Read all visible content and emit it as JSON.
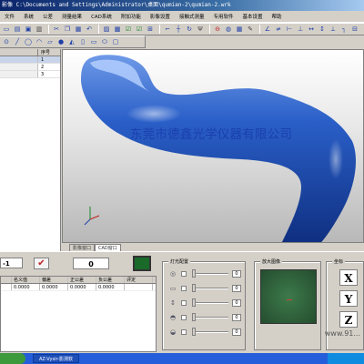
{
  "window": {
    "title": "影像  C:\\Documents and Settings\\Administrator\\桌面\\qumian-2\\qumian-2.wrk"
  },
  "menu": [
    "文件",
    "系统",
    "公差",
    "测量结果",
    "CAD系统",
    "附加功能",
    "影像设置",
    "接触式测量",
    "专用软件",
    "基本设置",
    "帮助"
  ],
  "toolbar_row1": {
    "icons": [
      "new-icon",
      "open-icon",
      "save-icon",
      "print-icon",
      "cut-icon",
      "copy-icon",
      "paste-icon",
      "undo-icon",
      "chart-icon",
      "measure-icon",
      "check-icon",
      "check-icon",
      "zoom-icon",
      "frame-icon",
      "crosshair-icon",
      "rotate-icon",
      "stop-icon",
      "camera-icon",
      "dim-icon",
      "line-icon",
      "angle-icon",
      "ruler-icon",
      "probe-icon",
      "light-icon",
      "grid-icon"
    ]
  },
  "left_panel": {
    "header": "序号",
    "rows": [
      "1",
      "2",
      "3"
    ]
  },
  "viewport": {
    "watermark": "东莞市德鑫光学仪器有限公司",
    "tabs": [
      "影像窗口",
      "CAD窗口"
    ],
    "active_tab": 1
  },
  "bottom": {
    "id_value": "-1",
    "count_value": "0",
    "table_headers": [
      "",
      "名义值",
      "偏差",
      "正公差",
      "负公差",
      "评定"
    ],
    "table_rows": [
      [
        "",
        "0.0000",
        "0.0000",
        "0.0000",
        "0.0000",
        ""
      ]
    ],
    "light_title": "灯光配置",
    "light_values": [
      "0",
      "0",
      "0",
      "0",
      "0"
    ],
    "zoom_title": "放大图像",
    "coord_title": "坐标",
    "axes": [
      "X",
      "Y",
      "Z"
    ],
    "website": "www.91..."
  },
  "taskbar": {
    "task_label": "AZ-Vysir-影测软"
  },
  "colors": {
    "title_start": "#0a246a",
    "watermark": "#1a3fb0",
    "model_blue": "#2a5fc8"
  }
}
